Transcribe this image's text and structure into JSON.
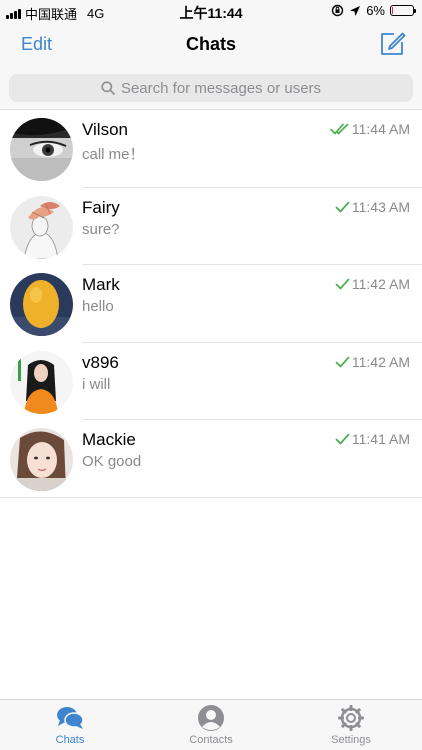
{
  "status_bar": {
    "carrier": "中国联通",
    "network": "4G",
    "time": "上午11:44",
    "battery_percent": "6%",
    "battery_level": 0.06
  },
  "nav": {
    "edit_label": "Edit",
    "title": "Chats",
    "compose_icon": "compose-icon"
  },
  "search": {
    "placeholder": "Search for messages or users",
    "icon": "search-icon"
  },
  "chats": [
    {
      "name": "Vilson",
      "preview": "call me！",
      "time": "11:44 AM",
      "status": "read",
      "check_icon": "double-check-icon",
      "avatar_icon": "photo-eye-closeup"
    },
    {
      "name": "Fairy",
      "preview": "sure?",
      "time": "11:43 AM",
      "status": "sent",
      "check_icon": "check-icon",
      "avatar_icon": "illustration-girl-flower"
    },
    {
      "name": "Mark",
      "preview": "hello",
      "time": "11:42 AM",
      "status": "sent",
      "check_icon": "check-icon",
      "avatar_icon": "photo-orange-fruit"
    },
    {
      "name": "v896",
      "preview": "i will",
      "time": "11:42 AM",
      "status": "sent",
      "check_icon": "check-icon",
      "avatar_icon": "photo-woman-orange"
    },
    {
      "name": "Mackie",
      "preview": "OK good",
      "time": "11:41 AM",
      "status": "sent",
      "check_icon": "check-icon",
      "avatar_icon": "photo-woman-selfie"
    }
  ],
  "tabs": [
    {
      "label": "Chats",
      "icon": "chat-bubbles-icon",
      "active": true
    },
    {
      "label": "Contacts",
      "icon": "person-icon",
      "active": false
    },
    {
      "label": "Settings",
      "icon": "gear-icon",
      "active": false
    }
  ],
  "colors": {
    "accent": "#3d86cf",
    "check_green": "#4caf50",
    "battery_low": "#e0292d"
  }
}
